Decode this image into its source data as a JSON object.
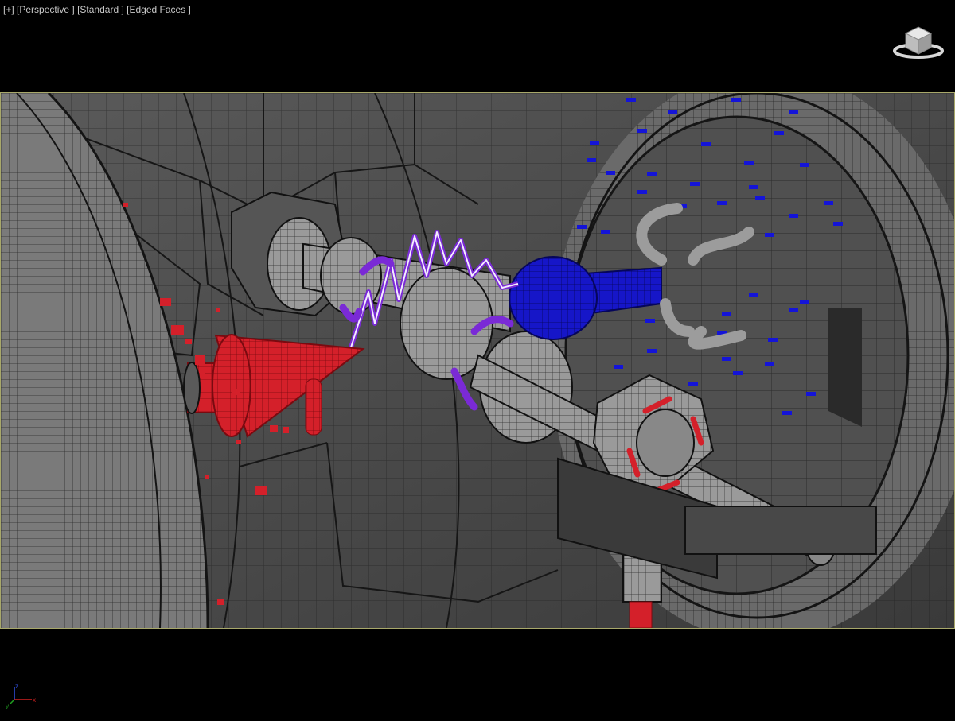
{
  "viewport": {
    "label_plus": "[+]",
    "label_view": "[Perspective ]",
    "label_shading": "[Standard ]",
    "label_edges": "[Edged Faces ]"
  },
  "viewcube": {
    "icon": "viewcube-icon"
  },
  "axis_tripod": {
    "x": "x",
    "y": "y",
    "z": "z"
  },
  "colors": {
    "background": "#000000",
    "frame_border": "#a8a86a",
    "mesh_gray": "#6e6e6e",
    "wire": "#1a1a1a",
    "red": "#d4202a",
    "blue": "#1010c8",
    "purple": "#7a2ad6",
    "axis_x": "#d02020",
    "axis_y": "#20a020",
    "axis_z": "#3050e0"
  }
}
